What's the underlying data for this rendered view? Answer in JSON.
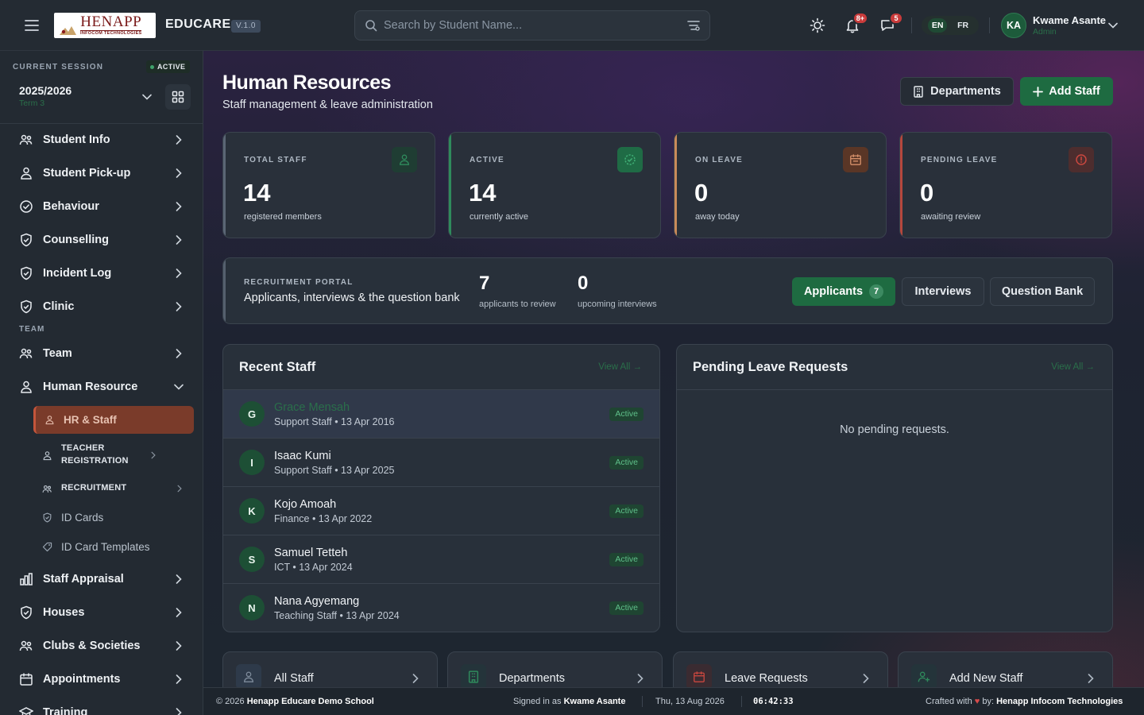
{
  "topbar": {
    "logo_main": "HENAPP",
    "logo_sub": "INFOCOM TECHNOLOGIES",
    "brand": "EDUCARE",
    "version": "V.1.0",
    "search_placeholder": "Search by Student Name...",
    "notifications_badge": "8+",
    "messages_badge": "5",
    "languages": [
      "EN",
      "FR"
    ],
    "user_initials": "KA",
    "user_name": "Kwame Asante",
    "user_role": "Admin"
  },
  "session": {
    "label": "CURRENT SESSION",
    "status": "ACTIVE",
    "year": "2025/2026",
    "term": "Term 3"
  },
  "sidebar": {
    "items": [
      {
        "label": "Student Info",
        "icon": "users-icon"
      },
      {
        "label": "Student Pick-up",
        "icon": "person-icon"
      },
      {
        "label": "Behaviour",
        "icon": "check-circle-icon"
      },
      {
        "label": "Counselling",
        "icon": "shield-icon"
      },
      {
        "label": "Incident Log",
        "icon": "shield-icon"
      },
      {
        "label": "Clinic",
        "icon": "shield-icon"
      }
    ],
    "section_team": "TEAM",
    "team_items": [
      {
        "label": "Team",
        "icon": "users-icon"
      },
      {
        "label": "Human Resource",
        "icon": "person-icon"
      }
    ],
    "hr_sub": [
      {
        "label": "HR & Staff"
      },
      {
        "label": "TEACHER REGISTRATION"
      },
      {
        "label": "RECRUITMENT"
      },
      {
        "label": "ID Cards"
      },
      {
        "label": "ID Card Templates"
      }
    ],
    "more_items": [
      {
        "label": "Staff Appraisal",
        "icon": "bar-chart-icon"
      },
      {
        "label": "Houses",
        "icon": "shield-icon"
      },
      {
        "label": "Clubs & Societies",
        "icon": "users-icon"
      },
      {
        "label": "Appointments",
        "icon": "calendar-icon"
      },
      {
        "label": "Training",
        "icon": "graduation-icon"
      }
    ]
  },
  "page": {
    "title": "Human Resources",
    "subtitle": "Staff management & leave administration",
    "btn_departments": "Departments",
    "btn_add_staff": "Add Staff"
  },
  "stats": [
    {
      "label": "TOTAL STAFF",
      "value": "14",
      "note": "registered members",
      "accent": "#5b6675",
      "icon_bg": "#1f3d33",
      "icon_color": "#2f8a5c"
    },
    {
      "label": "ACTIVE",
      "value": "14",
      "note": "currently active",
      "accent": "#2f8a5c",
      "icon_bg": "#1f6b45",
      "icon_color": "#3fae75"
    },
    {
      "label": "ON LEAVE",
      "value": "0",
      "note": "away today",
      "accent": "#c98a5a",
      "icon_bg": "#5a3626",
      "icon_color": "#d5906a"
    },
    {
      "label": "PENDING LEAVE",
      "value": "0",
      "note": "awaiting review",
      "accent": "#b5473d",
      "icon_bg": "#4d2d2e",
      "icon_color": "#c9473f"
    }
  ],
  "recruitment": {
    "label": "RECRUITMENT PORTAL",
    "subtitle": "Applicants, interviews & the question bank",
    "applicants_count": "7",
    "applicants_caption": "applicants to review",
    "interviews_count": "0",
    "interviews_caption": "upcoming interviews",
    "btn_applicants": "Applicants",
    "btn_applicants_badge": "7",
    "btn_interviews": "Interviews",
    "btn_question_bank": "Question Bank"
  },
  "recent_staff": {
    "title": "Recent Staff",
    "view_all": "View All →",
    "rows": [
      {
        "initial": "G",
        "name": "Grace Mensah",
        "meta": "Support Staff • 13 Apr 2016",
        "status": "Active"
      },
      {
        "initial": "I",
        "name": "Isaac Kumi",
        "meta": "Support Staff • 13 Apr 2025",
        "status": "Active"
      },
      {
        "initial": "K",
        "name": "Kojo Amoah",
        "meta": "Finance • 13 Apr 2022",
        "status": "Active"
      },
      {
        "initial": "S",
        "name": "Samuel Tetteh",
        "meta": "ICT • 13 Apr 2024",
        "status": "Active"
      },
      {
        "initial": "N",
        "name": "Nana Agyemang",
        "meta": "Teaching Staff • 13 Apr 2024",
        "status": "Active"
      }
    ]
  },
  "pending_leave": {
    "title": "Pending Leave Requests",
    "view_all": "View All →",
    "empty_text": "No pending requests."
  },
  "quick_links": [
    {
      "label": "All Staff",
      "icon": "users-icon",
      "icon_bg": "#2e3a4a",
      "icon_color": "#7d8a9a"
    },
    {
      "label": "Departments",
      "icon": "building-icon",
      "icon_bg": "#24343a",
      "icon_color": "#2f8a5c"
    },
    {
      "label": "Leave Requests",
      "icon": "calendar-icon",
      "icon_bg": "#3a2b31",
      "icon_color": "#c9473f"
    },
    {
      "label": "Add New Staff",
      "icon": "user-plus-icon",
      "icon_bg": "#24343a",
      "icon_color": "#2f8a5c"
    }
  ],
  "footer": {
    "copyright": "© 2026",
    "school": "Henapp Educare Demo School",
    "signed_prefix": "Signed in as",
    "signed_user": "Kwame Asante",
    "date": "Thu, 13 Aug 2026",
    "time": "06:42:33",
    "crafted_prefix": "Crafted with",
    "crafted_by": "by:",
    "company": "Henapp Infocom Technologies"
  }
}
